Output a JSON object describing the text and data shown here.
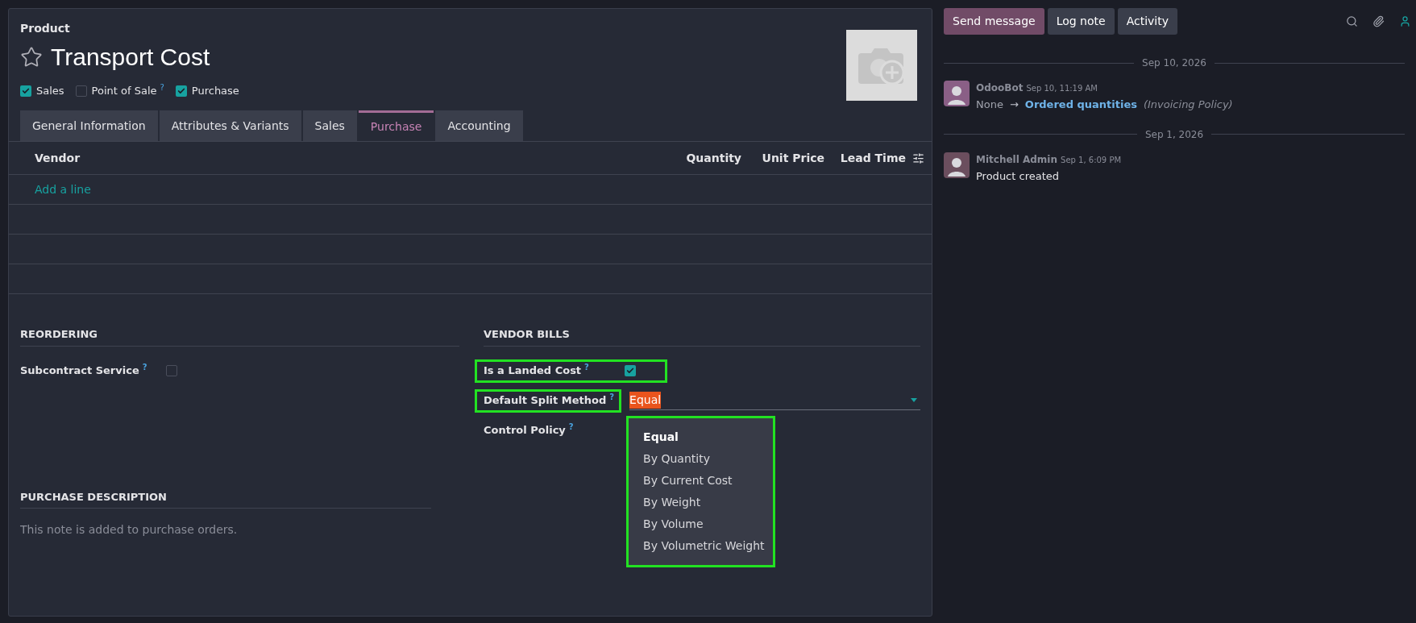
{
  "product": {
    "breadcrumb": "Product",
    "name": "Transport Cost",
    "favorite": false,
    "flags": [
      {
        "label": "Sales",
        "checked": true
      },
      {
        "label": "Point of Sale",
        "checked": false,
        "help": "?"
      },
      {
        "label": "Purchase",
        "checked": true
      }
    ]
  },
  "tabs": [
    {
      "label": "General Information",
      "selected": false
    },
    {
      "label": "Attributes & Variants",
      "selected": false
    },
    {
      "label": "Sales",
      "selected": false
    },
    {
      "label": "Purchase",
      "selected": true
    },
    {
      "label": "Accounting",
      "selected": false
    }
  ],
  "vendor_table": {
    "columns": [
      "Vendor",
      "Quantity",
      "Unit Price",
      "Lead Time"
    ],
    "add_line": "Add a line"
  },
  "reordering": {
    "title": "REORDERING",
    "fields": [
      {
        "label": "Subcontract Service",
        "help": "?",
        "kind": "checkbox",
        "checked": false,
        "highlighted": false
      }
    ]
  },
  "vendor_bills": {
    "title": "VENDOR BILLS",
    "fields": [
      {
        "label": "Is a Landed Cost",
        "help": "?",
        "kind": "checkbox",
        "checked": true,
        "highlighted": true
      },
      {
        "label": "Default Split Method",
        "help": "?",
        "kind": "select",
        "value": "Equal",
        "value_selected": true,
        "highlighted": true,
        "options": [
          {
            "label": "Equal",
            "selected": true
          },
          {
            "label": "By Quantity",
            "selected": false
          },
          {
            "label": "By Current Cost",
            "selected": false
          },
          {
            "label": "By Weight",
            "selected": false
          },
          {
            "label": "By Volume",
            "selected": false
          },
          {
            "label": "By Volumetric Weight",
            "selected": false
          }
        ],
        "options_highlighted": true
      },
      {
        "label": "Control Policy",
        "help": "?",
        "kind": "empty",
        "highlighted": false
      }
    ]
  },
  "purchase_description": {
    "title": "PURCHASE DESCRIPTION",
    "placeholder": "This note is added to purchase orders."
  },
  "chatter": {
    "buttons": [
      {
        "label": "Send message",
        "selected": true
      },
      {
        "label": "Log note",
        "selected": false
      },
      {
        "label": "Activity",
        "selected": false
      }
    ],
    "groups": [
      {
        "date": "Sep 10, 2026",
        "messages": [
          {
            "author": "OdooBot",
            "time": "Sep 10, 11:19 AM",
            "kind": "change",
            "old": "None",
            "arrow": "→",
            "new": "Ordered quantities",
            "field": "(Invoicing Policy)"
          }
        ]
      },
      {
        "date": "Sep 1, 2026",
        "messages": [
          {
            "author": "Mitchell Admin",
            "time": "Sep 1, 6:09 PM",
            "kind": "text",
            "text": "Product created"
          }
        ]
      }
    ]
  }
}
